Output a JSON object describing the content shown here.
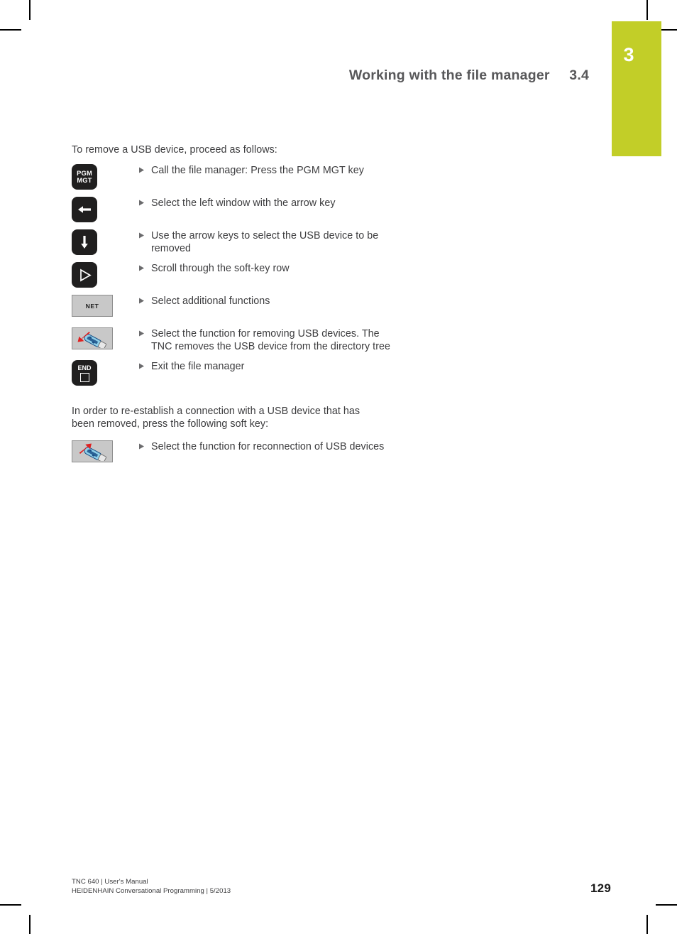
{
  "header": {
    "title": "Working with the file manager",
    "section": "3.4",
    "chapter_number": "3",
    "tab_color": "#c2ce28",
    "title_color": "#58585a"
  },
  "content": {
    "intro": "To remove a USB device, proceed as follows:",
    "reconnect_intro": "In order to re-establish a connection with a USB device that has been removed, press the following soft key:",
    "steps": [
      {
        "icon": "pgm-mgt-key",
        "icon_type": "hardkey-text",
        "key_lines": [
          "PGM",
          "MGT"
        ],
        "text": "Call the file manager: Press the PGM MGT key"
      },
      {
        "icon": "arrow-left-key",
        "icon_type": "hardkey-arrow-left",
        "key_lines": [],
        "text": "Select the left window with the arrow key"
      },
      {
        "icon": "arrow-down-key",
        "icon_type": "hardkey-arrow-down",
        "key_lines": [],
        "text": "Use the arrow keys to select the USB device to be removed"
      },
      {
        "icon": "soft-key-row-advance-key",
        "icon_type": "hardkey-triangle-right",
        "key_lines": [],
        "text": "Scroll through the soft-key row"
      },
      {
        "icon": "net-soft-key",
        "icon_type": "softkey-text",
        "key_lines": [
          "NET"
        ],
        "text": "Select additional functions"
      },
      {
        "icon": "usb-remove-soft-key",
        "icon_type": "softkey-usb-remove",
        "key_lines": [],
        "text": "Select the function for removing USB devices. The TNC removes the USB device from the directory tree"
      },
      {
        "icon": "end-key",
        "icon_type": "hardkey-end",
        "key_lines": [
          "END"
        ],
        "text": "Exit the file manager"
      }
    ],
    "reconnect_steps": [
      {
        "icon": "usb-reconnect-soft-key",
        "icon_type": "softkey-usb-reconnect",
        "key_lines": [],
        "text": "Select the function for reconnection of USB devices"
      }
    ]
  },
  "footer": {
    "line1": "TNC 640 | User's Manual",
    "line2": "HEIDENHAIN Conversational Programming | 5/2013",
    "page_number": "129"
  }
}
